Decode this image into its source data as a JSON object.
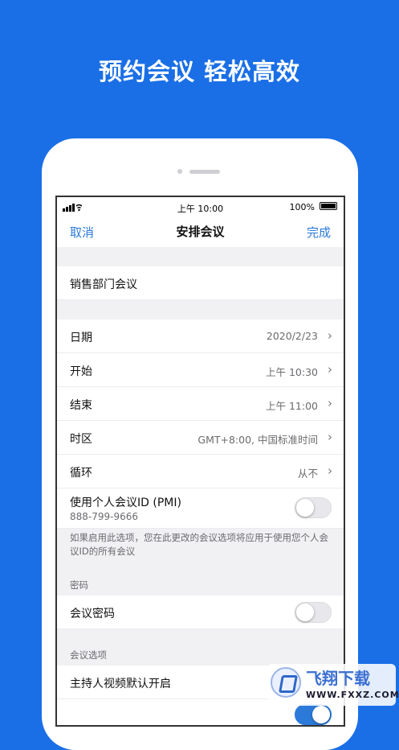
{
  "headline": "预约会议 轻松高效",
  "status_bar": {
    "time": "上午 10:00",
    "battery": "100%"
  },
  "nav": {
    "cancel": "取消",
    "title": "安排会议",
    "done": "完成"
  },
  "topic": "销售部门会议",
  "fields": [
    {
      "label": "日期",
      "value": "2020/2/23"
    },
    {
      "label": "开始",
      "value": "上午 10:30"
    },
    {
      "label": "结束",
      "value": "上午 11:00"
    },
    {
      "label": "时区",
      "value": "GMT+8:00, 中国标准时间"
    },
    {
      "label": "循环",
      "value": "从不"
    }
  ],
  "pmi": {
    "label": "使用个人会议ID (PMI)",
    "id": "888-799-9666",
    "enabled": false
  },
  "pmi_note": "如果启用此选项，您在此更改的会议选项将应用于使用您个人会议ID的所有会议",
  "password_section": {
    "header": "密码",
    "label": "会议密码",
    "enabled": false
  },
  "options_section": {
    "header": "会议选项",
    "host_video_label": "主持人视频默认开启",
    "host_video_enabled": true
  },
  "watermark": {
    "title": "飞翔下载",
    "url": "WWW.FXXZ.COM"
  },
  "icons": {
    "chevron": "chevron-right-icon",
    "signal": "signal-icon",
    "wifi": "wifi-icon",
    "battery": "battery-icon"
  },
  "colors": {
    "background": "#1a6fe6",
    "accent": "#2b7ad9"
  }
}
